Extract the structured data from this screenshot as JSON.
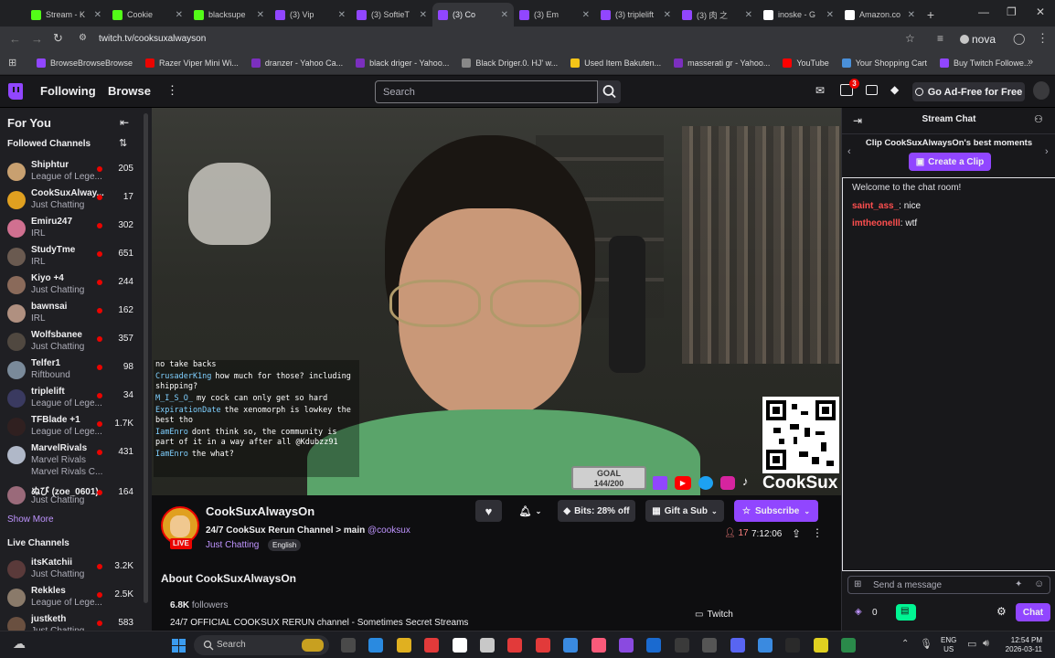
{
  "browser": {
    "tabs": [
      {
        "label": "Stream - K",
        "color": "#53fc18",
        "active": false
      },
      {
        "label": "Cookie",
        "color": "#53fc18",
        "active": false
      },
      {
        "label": "blacksupe",
        "color": "#53fc18",
        "active": false
      },
      {
        "label": "(3) Vip",
        "color": "#9146ff",
        "active": false
      },
      {
        "label": "(3) SoftieT",
        "color": "#9146ff",
        "active": false
      },
      {
        "label": "(3) Co",
        "color": "#9146ff",
        "active": true
      },
      {
        "label": "(3) Em",
        "color": "#9146ff",
        "active": false
      },
      {
        "label": "(3) triplelift",
        "color": "#9146ff",
        "active": false
      },
      {
        "label": "(3) 肉 之",
        "color": "#9146ff",
        "active": false
      },
      {
        "label": "inoske - G",
        "color": "#ffffff",
        "active": false
      },
      {
        "label": "Amazon.co",
        "color": "#ffffff",
        "active": false
      }
    ],
    "url": "twitch.tv/cooksuxalwayson",
    "profile_label": "nova",
    "bookmarks": [
      {
        "label": "BrowseBrowseBrowse",
        "color": "#9146ff"
      },
      {
        "label": "Razer Viper Mini Wi...",
        "color": "#eb0400"
      },
      {
        "label": "dranzer - Yahoo Ca...",
        "color": "#7b2fbe"
      },
      {
        "label": "black driger - Yahoo...",
        "color": "#7b2fbe"
      },
      {
        "label": "Black Driger.0. HJ' w...",
        "color": "#888888"
      },
      {
        "label": "Used Item Bakuten...",
        "color": "#f5c518"
      },
      {
        "label": "masserati gr - Yahoo...",
        "color": "#7b2fbe"
      },
      {
        "label": "YouTube",
        "color": "#ff0000"
      },
      {
        "label": "Your Shopping Cart",
        "color": "#4a90d9"
      },
      {
        "label": "Buy Twitch Followe...",
        "color": "#9146ff"
      }
    ]
  },
  "nav": {
    "following": "Following",
    "browse": "Browse",
    "search_placeholder": "Search",
    "notif_count": "3",
    "ad_free": "Go Ad-Free for Free"
  },
  "sidebar": {
    "for_you": "For You",
    "followed_title": "Followed Channels",
    "followed": [
      {
        "name": "Shiphtur",
        "category": "League of Lege...",
        "viewers": "205",
        "color": "#c8a070"
      },
      {
        "name": "CookSuxAlway...",
        "category": "Just Chatting",
        "viewers": "17",
        "color": "#e0a020"
      },
      {
        "name": "Emiru247",
        "category": "IRL",
        "viewers": "302",
        "color": "#d07090"
      },
      {
        "name": "StudyTme",
        "category": "IRL",
        "viewers": "651",
        "color": "#6a5a50"
      },
      {
        "name": "Kiyo +4",
        "category": "Just Chatting",
        "viewers": "244",
        "color": "#8a6a5a"
      },
      {
        "name": "bawnsai",
        "category": "IRL",
        "viewers": "162",
        "color": "#b09080"
      },
      {
        "name": "Wolfsbanee",
        "category": "Just Chatting",
        "viewers": "357",
        "color": "#504840"
      },
      {
        "name": "Telfer1",
        "category": "Riftbound",
        "viewers": "98",
        "color": "#7a8a9a"
      },
      {
        "name": "triplelift",
        "category": "League of Lege...",
        "viewers": "34",
        "color": "#3a3a60"
      },
      {
        "name": "TFBlade +1",
        "category": "League of Lege...",
        "viewers": "1.7K",
        "color": "#302020"
      },
      {
        "name": "MarvelRivals",
        "category": "Marvel Rivals",
        "category2": "Marvel Rivals C...",
        "viewers": "431",
        "color": "#b0b8c8"
      },
      {
        "name": "ぬび (zoe_0601)",
        "category": "Just Chatting",
        "viewers": "164",
        "color": "#9a6a7a"
      }
    ],
    "show_more": "Show More",
    "live_title": "Live Channels",
    "live": [
      {
        "name": "itsKatchii",
        "category": "Just Chatting",
        "viewers": "3.2K",
        "color": "#5a3a3a"
      },
      {
        "name": "Rekkles",
        "category": "League of Lege...",
        "viewers": "2.5K",
        "color": "#8a7a6a"
      },
      {
        "name": "justketh",
        "category": "Just Chatting",
        "viewers": "583",
        "color": "#6a5040"
      }
    ]
  },
  "stream_overlay": {
    "chat_lines": [
      {
        "user": "",
        "text": "no take backs"
      },
      {
        "user": "CrusaderK1ng",
        "text": "how much for those? including shipping?"
      },
      {
        "user": "M_I_S_O_",
        "text": "my cock can only get so hard"
      },
      {
        "user": "ExpirationDate",
        "text": "the xenomorph is lowkey the best tho"
      },
      {
        "user": "IamEnro",
        "text": "dont think so, the community is part of it in a way after all @Kdubzz91"
      },
      {
        "user": "IamEnro",
        "text": "the what?"
      }
    ],
    "goal_label": "GOAL",
    "goal_value": "144/200",
    "brand": "CookSux"
  },
  "channel": {
    "name": "CookSuxAlwaysOn",
    "title": "24/7 CookSux Rerun Channel > main",
    "mention": "@cooksux",
    "live_badge": "LIVE",
    "category": "Just Chatting",
    "language": "English",
    "bits_label": "Bits: 28% off",
    "gift_label": "Gift a Sub",
    "subscribe_label": "Subscribe",
    "viewers": "17",
    "uptime": "7:12:06",
    "about_title": "About CookSuxAlwaysOn",
    "followers_count": "6.8K",
    "followers_word": "followers",
    "description": "24/7 OFFICIAL COOKSUX RERUN channel - Sometimes Secret Streams",
    "twitch_link": "Twitch"
  },
  "chat": {
    "title": "Stream Chat",
    "clip_banner": "Clip CookSuxAlwaysOn's best moments",
    "create_clip": "Create a Clip",
    "welcome": "Welcome to the chat room!",
    "messages": [
      {
        "user": "saint_ass_",
        "text": ": nice",
        "color": "#ff4f4f"
      },
      {
        "user": "imtheonelll",
        "text": ": wtf",
        "color": "#ff4f4f"
      }
    ],
    "input_placeholder": "Send a message",
    "points": "0",
    "chat_button": "Chat"
  },
  "taskbar": {
    "search_label": "Search",
    "lang1": "ENG",
    "lang2": "US",
    "time": "12:54 PM",
    "date": "2026-03-11"
  }
}
